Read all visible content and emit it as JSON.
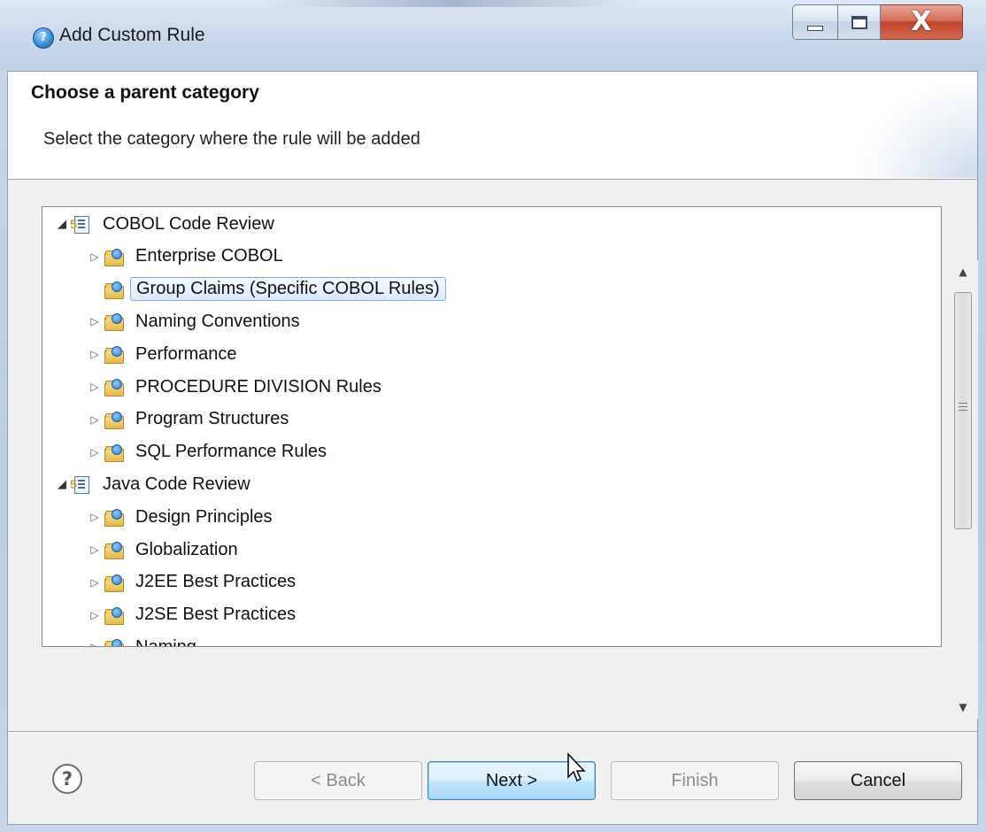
{
  "window": {
    "title": "Add Custom Rule",
    "controls": {
      "minimize": "minimize",
      "maximize": "maximize",
      "close": "X"
    }
  },
  "banner": {
    "title": "Choose a parent category",
    "description": "Select the category where the rule will be added"
  },
  "tree": {
    "nodes": [
      {
        "label": "COBOL Code Review",
        "type": "project",
        "expanded": true,
        "level": 0
      },
      {
        "label": "Enterprise COBOL",
        "type": "folder",
        "expandable": true,
        "level": 1
      },
      {
        "label": "Group Claims (Specific COBOL Rules)",
        "type": "folder",
        "expandable": false,
        "selected": true,
        "level": 1
      },
      {
        "label": "Naming Conventions",
        "type": "folder",
        "expandable": true,
        "level": 1
      },
      {
        "label": "Performance",
        "type": "folder",
        "expandable": true,
        "level": 1
      },
      {
        "label": "PROCEDURE DIVISION Rules",
        "type": "folder",
        "expandable": true,
        "level": 1
      },
      {
        "label": "Program Structures",
        "type": "folder",
        "expandable": true,
        "level": 1
      },
      {
        "label": "SQL Performance Rules",
        "type": "folder",
        "expandable": true,
        "level": 1
      },
      {
        "label": "Java Code Review",
        "type": "project",
        "expanded": true,
        "level": 0
      },
      {
        "label": "Design Principles",
        "type": "folder",
        "expandable": true,
        "level": 1
      },
      {
        "label": "Globalization",
        "type": "folder",
        "expandable": true,
        "level": 1
      },
      {
        "label": "J2EE Best Practices",
        "type": "folder",
        "expandable": true,
        "level": 1
      },
      {
        "label": "J2SE Best Practices",
        "type": "folder",
        "expandable": true,
        "level": 1
      },
      {
        "label": "Naming",
        "type": "folder",
        "expandable": true,
        "level": 1
      }
    ]
  },
  "footer": {
    "help_label": "?",
    "back_label": "< Back",
    "next_label": "Next >",
    "finish_label": "Finish",
    "cancel_label": "Cancel"
  },
  "colors": {
    "selection_border": "#84acdd",
    "default_button_border": "#3c7fb1",
    "close_button": "#c0432b"
  }
}
